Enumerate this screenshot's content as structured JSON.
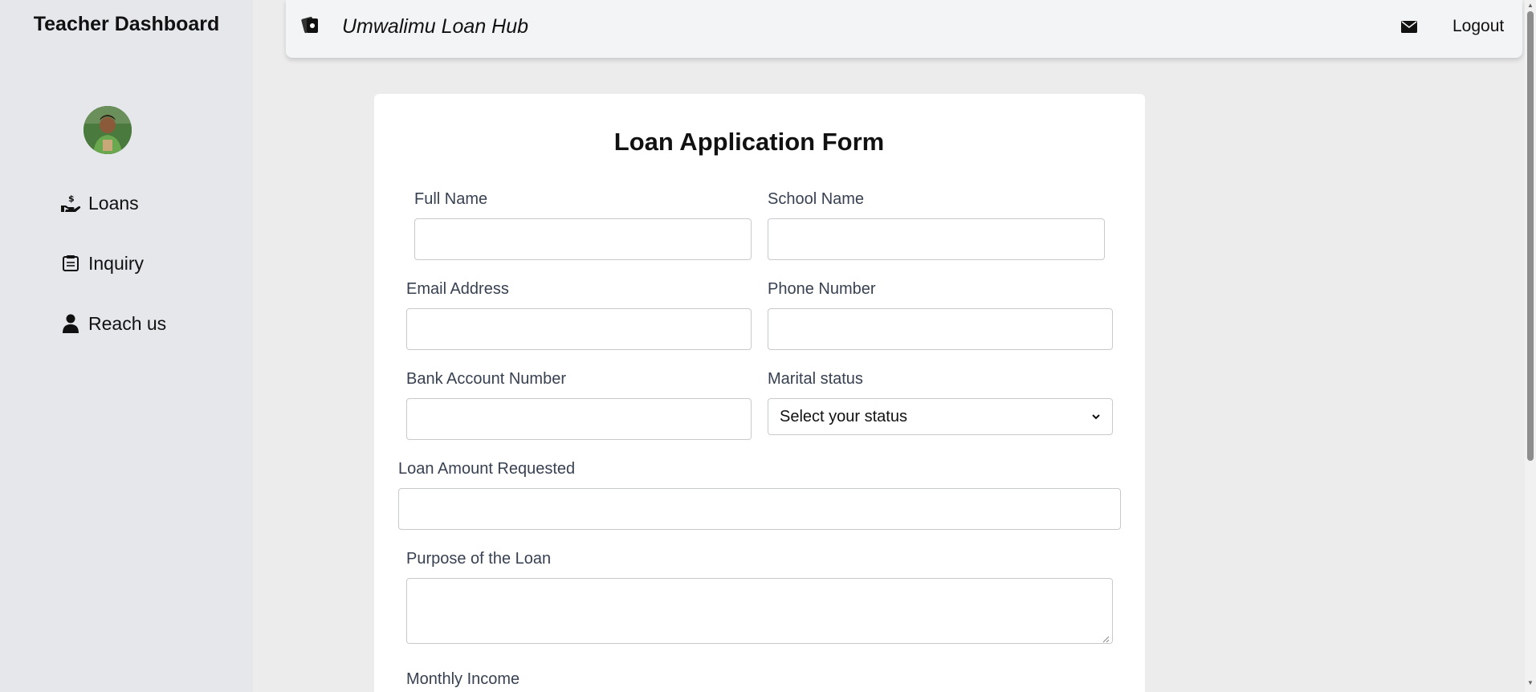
{
  "sidebar": {
    "title": "Teacher Dashboard",
    "items": [
      {
        "label": "Loans",
        "icon": "hand-dollar-icon"
      },
      {
        "label": "Inquiry",
        "icon": "clipboard-icon"
      },
      {
        "label": "Reach us",
        "icon": "user-icon"
      }
    ]
  },
  "header": {
    "brand_title": "Umwalimu Loan Hub",
    "logout_label": "Logout",
    "icons": [
      "brand-icon",
      "mail-icon"
    ]
  },
  "form": {
    "title": "Loan Application Form",
    "full_name_label": "Full Name",
    "school_name_label": "School Name",
    "email_label": "Email Address",
    "phone_label": "Phone Number",
    "bank_label": "Bank Account Number",
    "marital_label": "Marital status",
    "marital_selected": "Select your status",
    "loan_amount_label": "Loan Amount Requested",
    "purpose_label": "Purpose of the Loan",
    "income_label": "Monthly Income"
  }
}
